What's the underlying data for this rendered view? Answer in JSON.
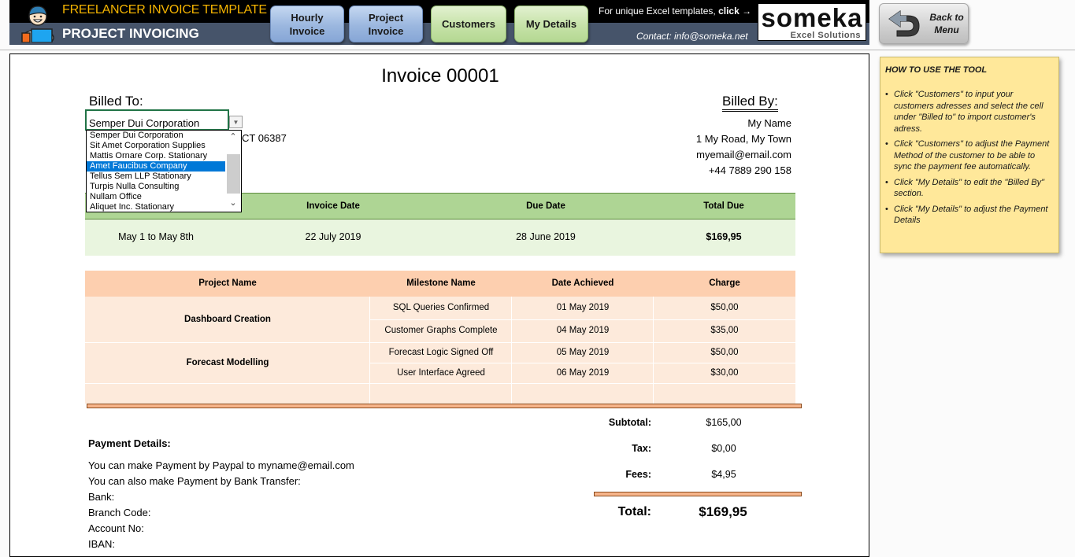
{
  "header": {
    "title": "FREELANCER INVOICE TEMPLATE",
    "subtitle": "PROJECT INVOICING",
    "nav": [
      {
        "line1": "Hourly",
        "line2": "Invoice"
      },
      {
        "line1": "Project",
        "line2": "Invoice"
      },
      {
        "line1": "Customers",
        "line2": ""
      },
      {
        "line1": "My Details",
        "line2": ""
      }
    ],
    "promo_text": "For unique Excel templates, ",
    "promo_click": "click →",
    "contact": "Contact: info@someka.net",
    "logo_main": "someka",
    "logo_sub": "Excel Solutions",
    "back_button": {
      "line1": "Back to",
      "line2": "Menu"
    }
  },
  "invoice": {
    "title": "Invoice 00001",
    "billed_to_label": "Billed To:",
    "billed_by_label": "Billed By:",
    "customer_selected": "Semper Dui Corporation",
    "customer_options": [
      "Semper Dui Corporation",
      "Sit Amet Corporation Supplies",
      "Mattis Ornare Corp. Stationary",
      "Amet Faucibus Company",
      "Tellus Sem LLP Stationary",
      "Turpis Nulla Consulting",
      "Nullam Office",
      "Aliquet Inc. Stationary"
    ],
    "customer_highlighted": "Amet Faucibus Company",
    "customer_address_partial": "CT 06387",
    "billed_by": [
      "My Name",
      "1 My Road, My Town",
      "myemail@email.com",
      "+44 7889 290 158"
    ]
  },
  "summary": {
    "headers": [
      "",
      "Invoice Date",
      "Due Date",
      "Total Due"
    ],
    "values": [
      "May 1 to May 8th",
      "22 July 2019",
      "28 June 2019",
      "$169,95"
    ]
  },
  "projects": {
    "headers": [
      "Project Name",
      "Milestone Name",
      "Date Achieved",
      "Charge"
    ],
    "groups": [
      {
        "project": "Dashboard Creation",
        "milestones": [
          {
            "name": "SQL Queries Confirmed",
            "date": "01 May 2019",
            "charge": "$50,00"
          },
          {
            "name": "Customer Graphs Complete",
            "date": "04 May 2019",
            "charge": "$35,00"
          }
        ]
      },
      {
        "project": "Forecast Modelling",
        "milestones": [
          {
            "name": "Forecast Logic Signed Off",
            "date": "05 May 2019",
            "charge": "$50,00"
          },
          {
            "name": "User Interface Agreed",
            "date": "06 May 2019",
            "charge": "$30,00"
          }
        ]
      }
    ]
  },
  "payment": {
    "title": "Payment Details:",
    "lines": [
      "You can make Payment by Paypal to myname@email.com",
      "You can also make Payment by Bank Transfer:",
      "Bank:",
      "Branch Code:",
      "Account No:",
      "IBAN:"
    ]
  },
  "totals": {
    "subtotal_label": "Subtotal:",
    "subtotal": "$165,00",
    "tax_label": "Tax:",
    "tax": "$0,00",
    "fees_label": "Fees:",
    "fees": "$4,95",
    "total_label": "Total:",
    "total": "$169,95"
  },
  "help": {
    "title": "HOW TO USE THE TOOL",
    "items": [
      "Click \"Customers\" to input your customers adresses and select the cell under \"Billed to\" to import customer's adress.",
      "Click \"Customers\" to adjust the Payment Method of the customer to be able to sync the payment fee automatically.",
      "Click \"My Details\" to edit the \"Billed By\" section.",
      "Click \"My Details\" to adjust the Payment Details"
    ]
  },
  "colors": {
    "banner_dark": "#46546a",
    "title_gold": "#f5b400",
    "summary_green": "#aed594",
    "project_orange": "#fdcfaf",
    "note_yellow": "#ffe89a",
    "selection_blue": "#0078d7"
  }
}
